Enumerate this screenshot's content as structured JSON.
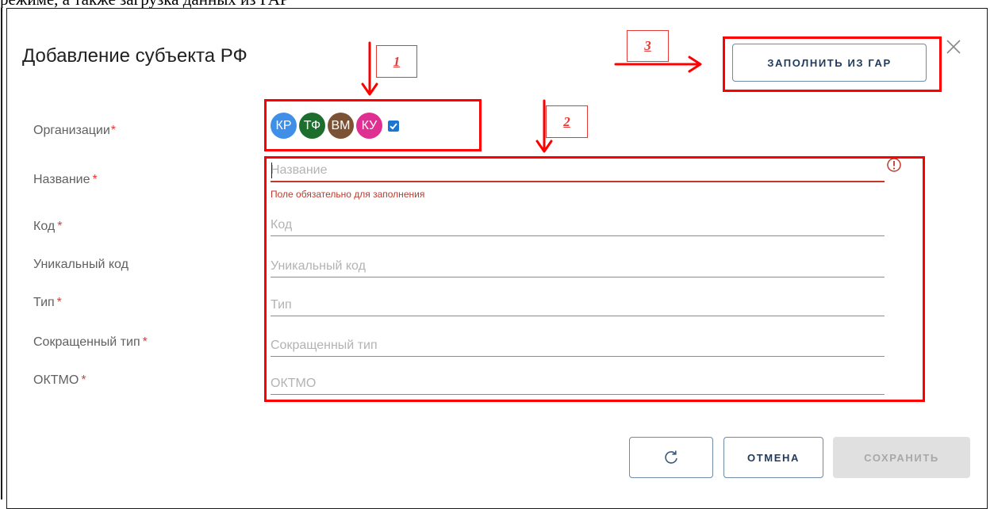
{
  "doc_text": "режиме, а также загрузка данных из ГАР",
  "dialog": {
    "title": "Добавление субъекта РФ",
    "fill_from_gar_button": "ЗАПОЛНИТЬ ИЗ ГАР",
    "close_icon": "close-icon"
  },
  "fields": {
    "organizations": {
      "label": "Организации",
      "required_mark": "*",
      "avatars": [
        {
          "initials": "КР",
          "color": "#3f8ee8"
        },
        {
          "initials": "ТФ",
          "color": "#1b6e2c"
        },
        {
          "initials": "ВМ",
          "color": "#7b5234"
        },
        {
          "initials": "КУ",
          "color": "#e02f93"
        }
      ],
      "checkbox_checked": true,
      "checkbox_color": "#1976d2"
    },
    "name": {
      "label": "Название",
      "required_mark": "*",
      "placeholder": "Название",
      "value": "",
      "error": "Поле обязательно для заполнения"
    },
    "code": {
      "label": "Код",
      "required_mark": "*",
      "placeholder": "Код",
      "value": ""
    },
    "unique_code": {
      "label": "Уникальный код",
      "placeholder": "Уникальный код",
      "value": ""
    },
    "type": {
      "label": "Тип",
      "required_mark": "*",
      "placeholder": "Тип",
      "value": ""
    },
    "short_type": {
      "label": "Сокращенный тип",
      "required_mark": "*",
      "placeholder": "Сокращенный тип",
      "value": ""
    },
    "oktmo": {
      "label": "ОКТМО",
      "required_mark": "*",
      "placeholder": "ОКТМО",
      "value": ""
    }
  },
  "footer": {
    "reset_icon": "refresh-icon",
    "cancel_label": "ОТМЕНА",
    "save_label": "СОХРАНИТЬ"
  },
  "annotations": {
    "callout_1": "1",
    "callout_2": "2",
    "callout_3": "3",
    "color": "#ff0000"
  },
  "colors": {
    "error": "#c0392b",
    "required": "#e53935",
    "primary_text": "#1e3a5f"
  }
}
